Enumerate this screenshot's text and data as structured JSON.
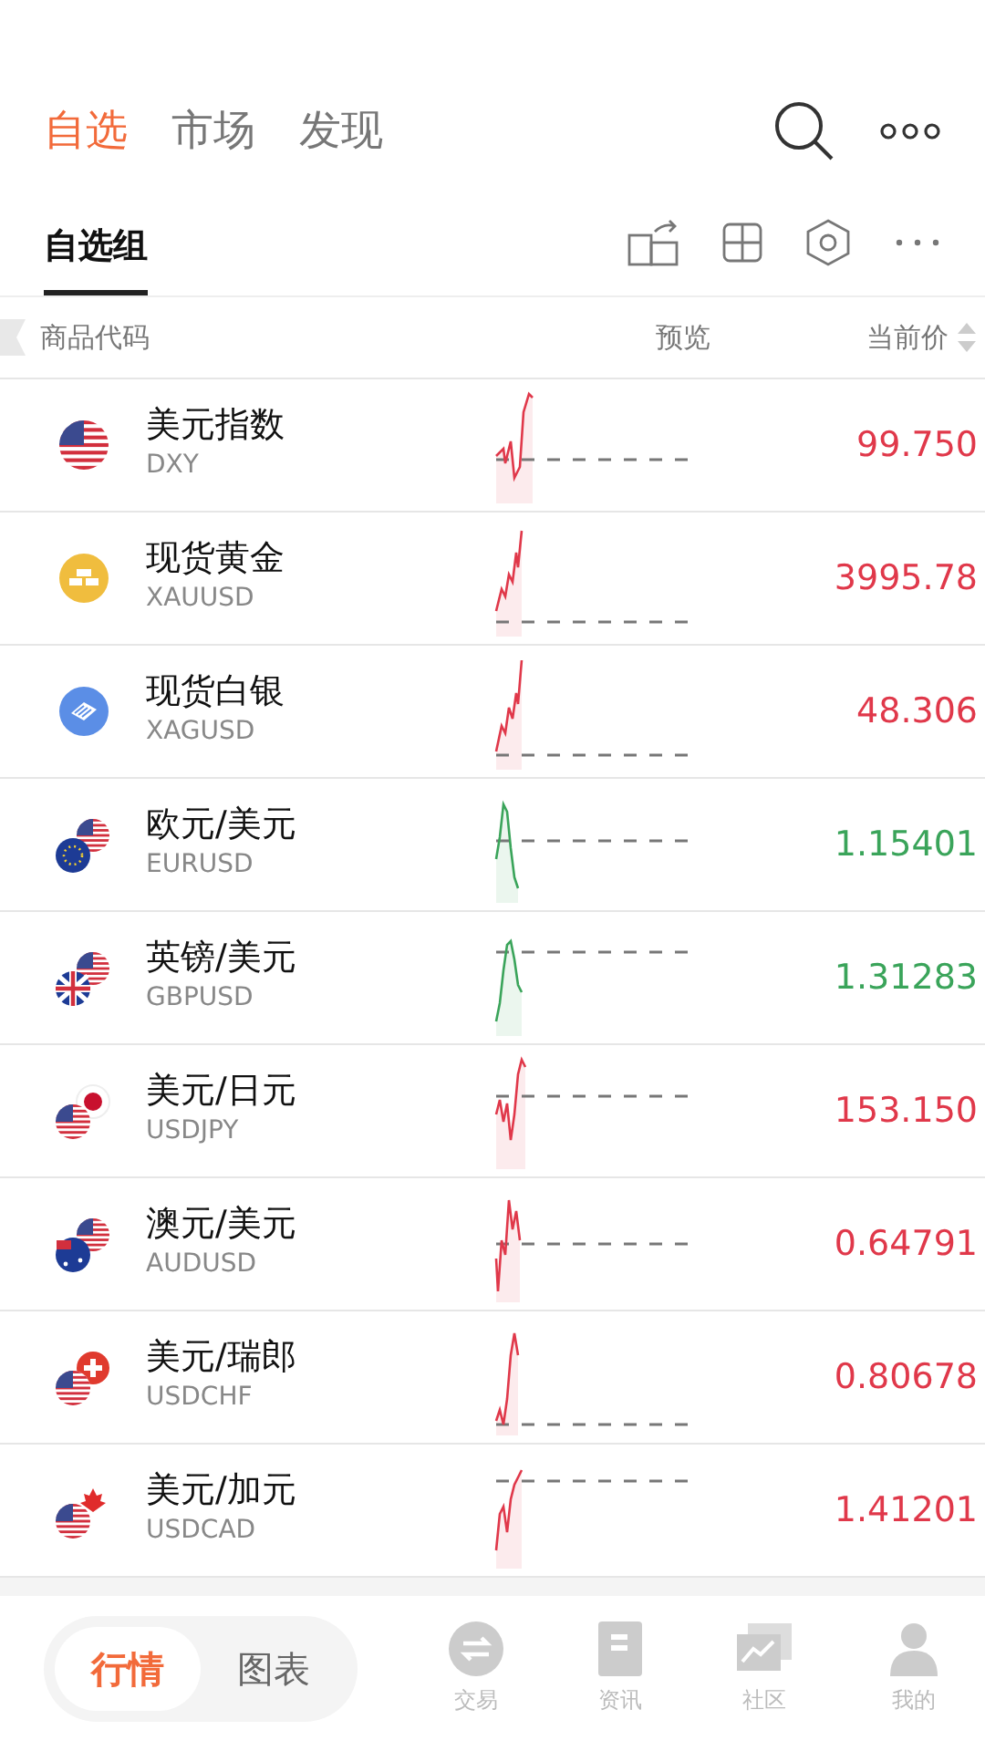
{
  "top_tabs": [
    {
      "label": "自选",
      "selected": true
    },
    {
      "label": "市场",
      "selected": false
    },
    {
      "label": "发现",
      "selected": false
    }
  ],
  "group_tab": {
    "label": "自选组",
    "selected": true
  },
  "columns": [
    "商品代码",
    "预览",
    "当前价"
  ],
  "rows": [
    {
      "name": "美元指数",
      "code": "DXY",
      "price": "99.750",
      "rising": true
    },
    {
      "name": "现货黄金",
      "code": "XAUUSD",
      "price": "3995.78",
      "rising": true
    },
    {
      "name": "现货白银",
      "code": "XAGUSD",
      "price": "48.306",
      "rising": true
    },
    {
      "name": "欧元/美元",
      "code": "EURUSD",
      "price": "1.15401",
      "rising": false
    },
    {
      "name": "英镑/美元",
      "code": "GBPUSD",
      "price": "1.31283",
      "rising": false
    },
    {
      "name": "美元/日元",
      "code": "USDJPY",
      "price": "153.150",
      "rising": true
    },
    {
      "name": "澳元/美元",
      "code": "AUDUSD",
      "price": "0.64791",
      "rising": true
    },
    {
      "name": "美元/瑞郎",
      "code": "USDCHF",
      "price": "0.80678",
      "rising": true
    },
    {
      "name": "美元/加元",
      "code": "USDCAD",
      "price": "1.41201",
      "rising": true
    }
  ],
  "view_toggle": [
    {
      "label": "行情",
      "selected": true
    },
    {
      "label": "图表",
      "selected": false
    }
  ],
  "bottom_nav": [
    {
      "label": "交易"
    },
    {
      "label": "资讯"
    },
    {
      "label": "社区"
    },
    {
      "label": "我的"
    }
  ]
}
